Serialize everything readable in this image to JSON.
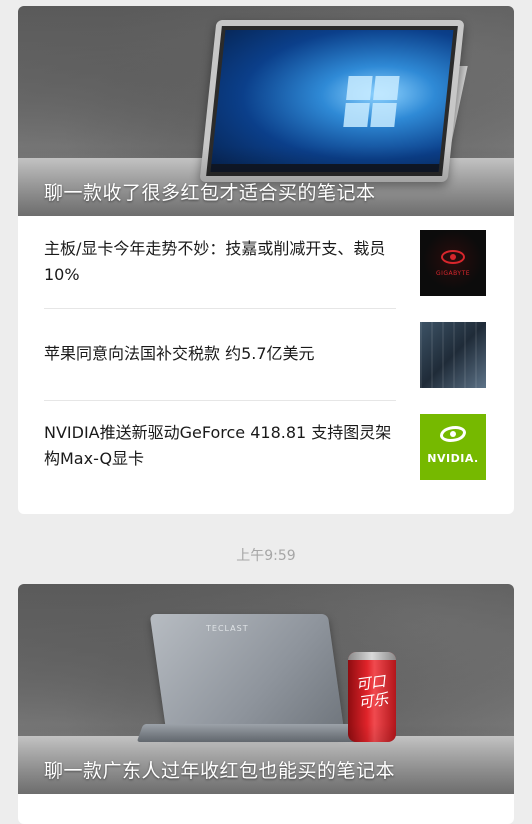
{
  "feed": {
    "article_group_1": {
      "cover_title": "聊一款收了很多红包才适合买的笔记本",
      "items": [
        {
          "title": "主板/显卡今年走势不妙：技嘉或削减开支、裁员10%",
          "thumb_icon": "gigabyte-logo-icon",
          "thumb_text": "GIGABYTE"
        },
        {
          "title": "苹果同意向法国补交税款 约5.7亿美元",
          "thumb_icon": "apple-logo-icon",
          "thumb_glyph": ""
        },
        {
          "title": "NVIDIA推送新驱动GeForce 418.81 支持图灵架构Max-Q显卡",
          "thumb_icon": "nvidia-logo-icon",
          "thumb_text": "NVIDIA."
        }
      ]
    },
    "timestamp": "上午9:59",
    "article_group_2": {
      "cover_title": "聊一款广东人过年收红包也能买的笔记本",
      "laptop_brand": "TECLAST",
      "can_text": "可口可乐"
    }
  },
  "colors": {
    "background": "#ededed",
    "card": "#ffffff",
    "title_text": "#1a1a1a",
    "timestamp_text": "#a6a6a6",
    "nvidia_green": "#76b900",
    "coke_red": "#e0242a"
  }
}
